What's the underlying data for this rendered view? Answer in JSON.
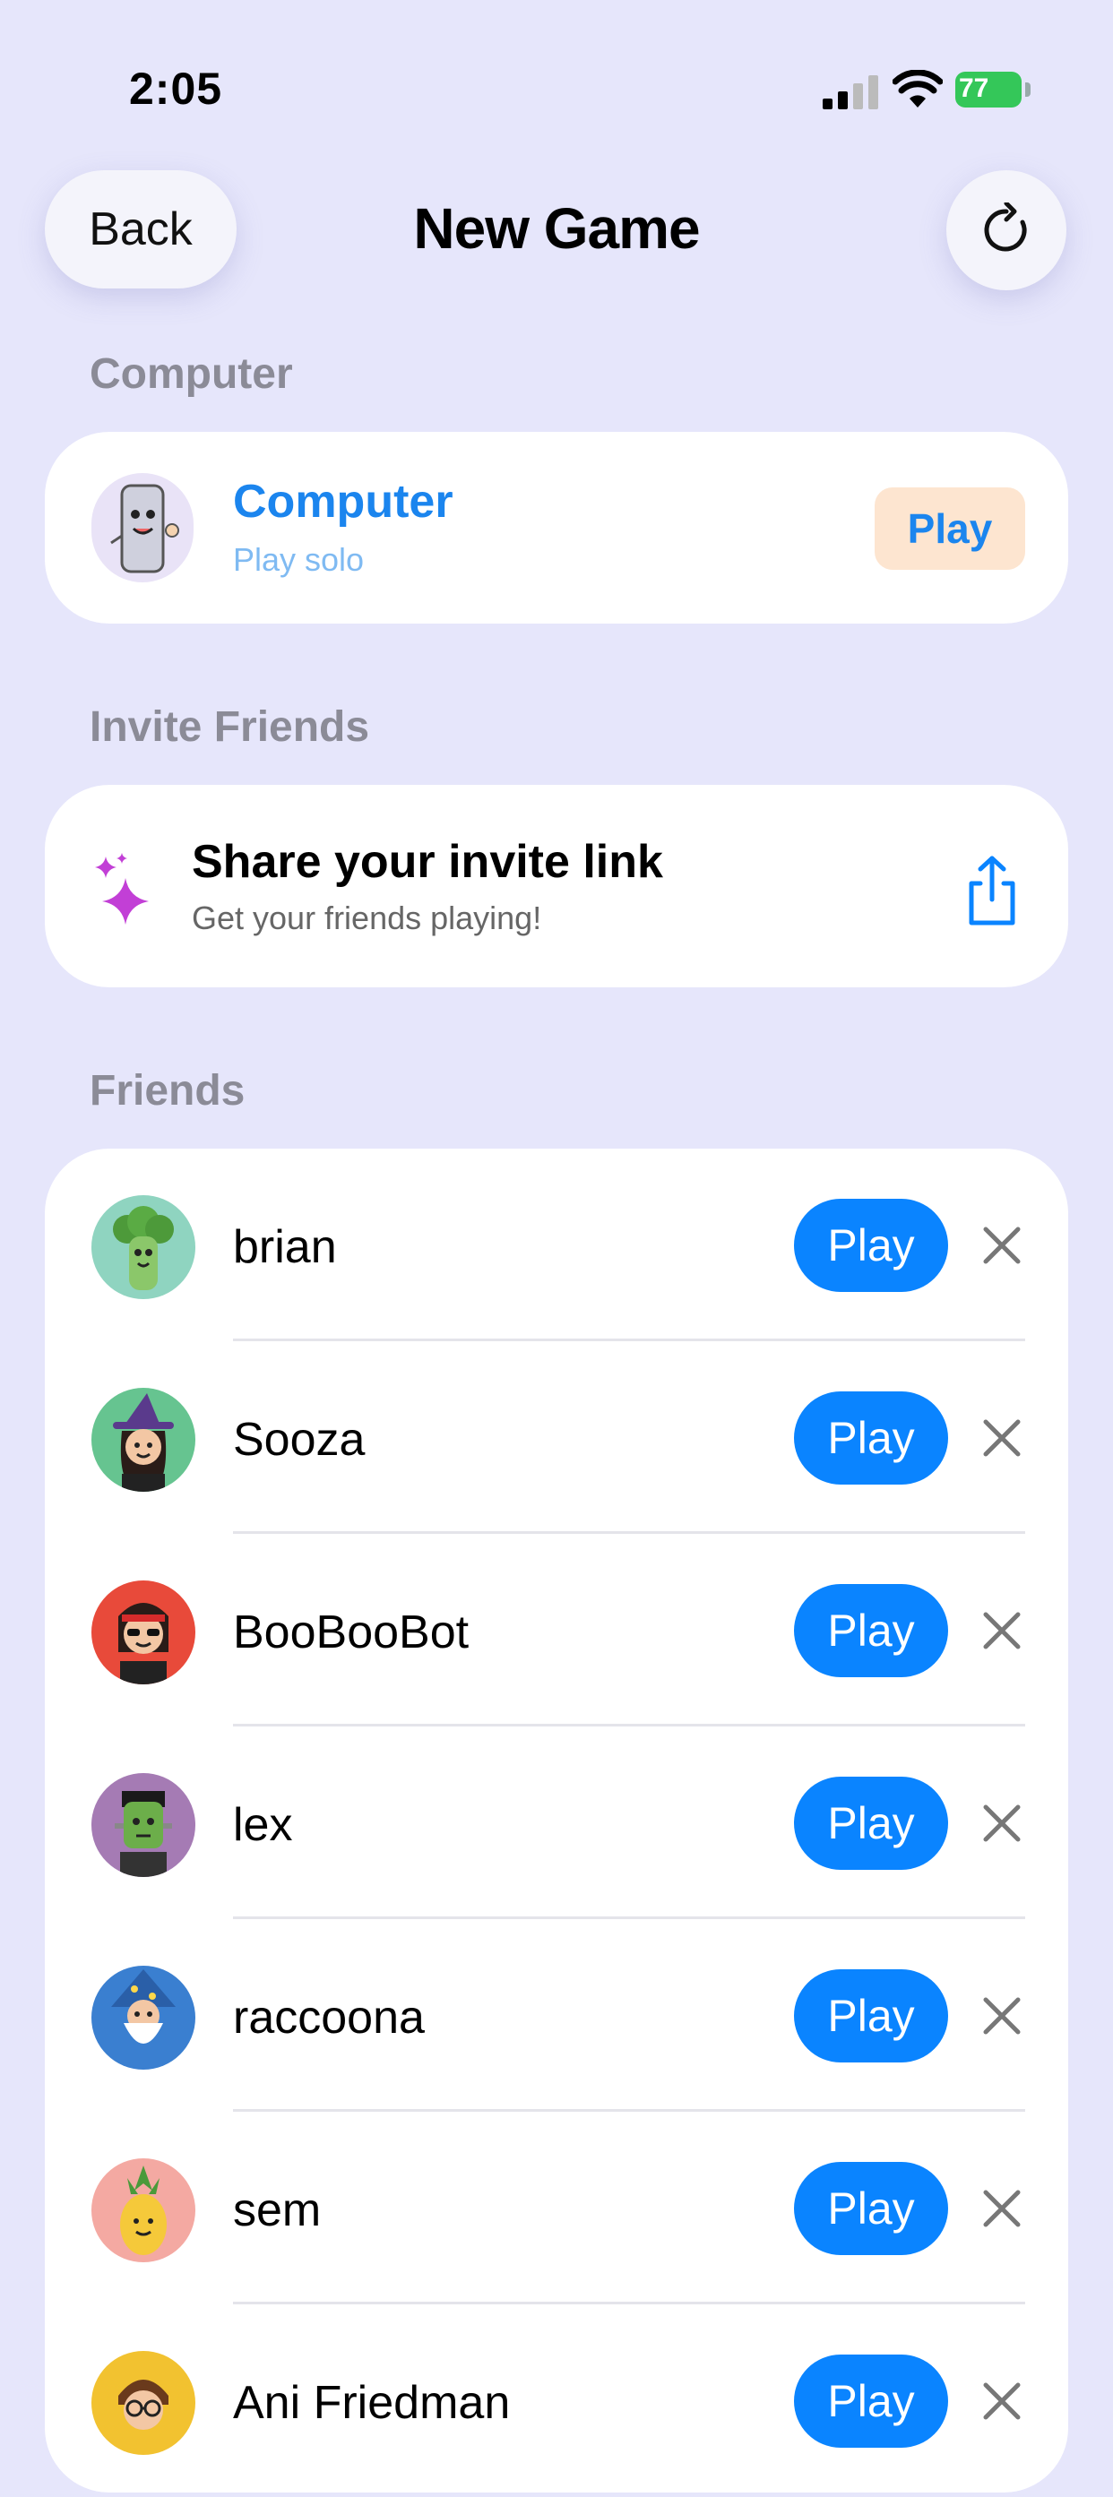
{
  "status_bar": {
    "time": "2:05",
    "battery": "77"
  },
  "nav": {
    "back_label": "Back",
    "title": "New Game"
  },
  "sections": {
    "computer": {
      "label": "Computer",
      "name": "Computer",
      "subtitle": "Play solo",
      "play_label": "Play"
    },
    "invite": {
      "label": "Invite Friends",
      "title": "Share your invite link",
      "subtitle": "Get your friends playing!"
    },
    "friends": {
      "label": "Friends",
      "play_label": "Play",
      "items": [
        {
          "name": "brian",
          "avatar": "broccoli-avatar",
          "bg": "#8fd4c0"
        },
        {
          "name": "Sooza",
          "avatar": "witch-avatar",
          "bg": "#66c490"
        },
        {
          "name": "BooBooBot",
          "avatar": "rocker-avatar",
          "bg": "#e84a3a"
        },
        {
          "name": "lex",
          "avatar": "frankenstein-avatar",
          "bg": "#a57bb4"
        },
        {
          "name": "raccoona",
          "avatar": "wizard-avatar",
          "bg": "#3a7fd0"
        },
        {
          "name": "sem",
          "avatar": "pineapple-avatar",
          "bg": "#f4a9a2"
        },
        {
          "name": "Ani Friedman",
          "avatar": "glasses-avatar",
          "bg": "#f2c230"
        }
      ]
    }
  },
  "colors": {
    "accent": "#0a84ff",
    "background": "#e6e6fb",
    "play_soft": "#fde5d0"
  }
}
